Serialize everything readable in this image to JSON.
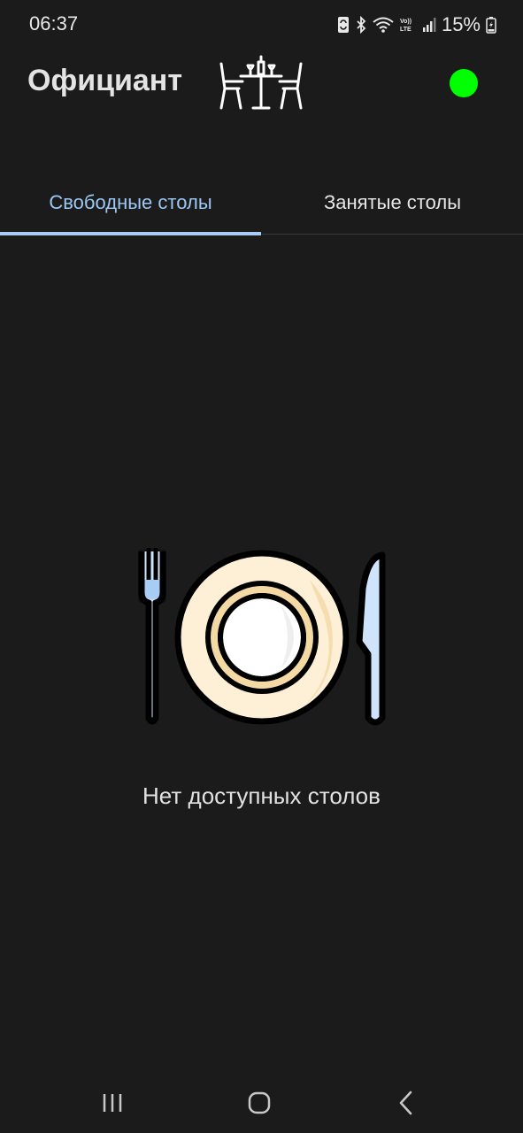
{
  "status_bar": {
    "time": "06:37",
    "battery": "15%",
    "icons": [
      "sync-icon",
      "bluetooth-icon",
      "wifi-icon",
      "volte-icon",
      "signal-icon",
      "battery-icon"
    ]
  },
  "header": {
    "title": "Официант",
    "icon": "restaurant-table-icon",
    "status_color": "#00ff00"
  },
  "tabs": [
    {
      "label": "Свободные столы",
      "active": true
    },
    {
      "label": "Занятые столы",
      "active": false
    }
  ],
  "empty_state": {
    "icon": "plate-fork-knife-icon",
    "message": "Нет доступных столов"
  },
  "nav_bar": {
    "buttons": [
      "recent-apps-icon",
      "home-icon",
      "back-icon"
    ]
  },
  "colors": {
    "background": "#1b1b1b",
    "accent": "#a8cdf5",
    "online": "#00ff00"
  }
}
